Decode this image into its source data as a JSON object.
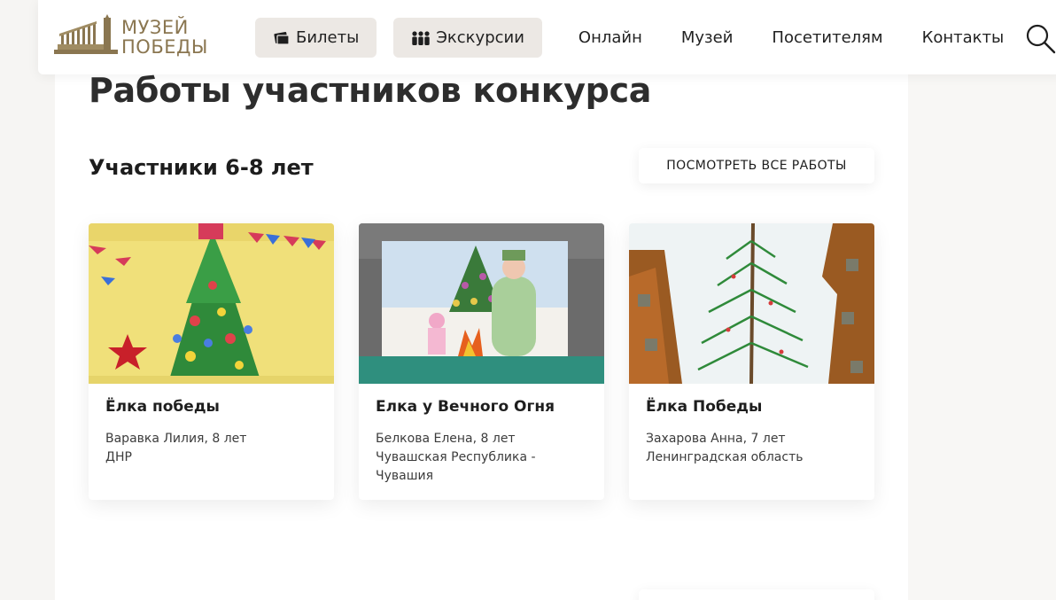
{
  "header": {
    "logo": {
      "line1": "МУЗЕЙ",
      "line2": "ПОБЕДЫ"
    },
    "nav_pills": [
      {
        "label": "Билеты",
        "icon": "ticket-icon"
      },
      {
        "label": "Экскурсии",
        "icon": "people-icon"
      }
    ],
    "nav_links": [
      "Онлайн",
      "Музей",
      "Посетителям",
      "Контакты"
    ],
    "search_icon": "search-icon"
  },
  "page": {
    "title": "Работы участников конкурса",
    "section_title": "Участники 6-8 лет",
    "view_all_label": "ПОСМОТРЕТЬ ВСЕ РАБОТЫ"
  },
  "cards": [
    {
      "title": "Ёлка победы",
      "author": "Варавка Лилия, 8 лет",
      "region": "ДНР"
    },
    {
      "title": "Елка у Вечного Огня",
      "author": "Белкова Елена, 8 лет",
      "region": "Чувашская Республика - Чувашия"
    },
    {
      "title": "Ёлка Победы",
      "author": "Захарова Анна, 7 лет",
      "region": "Ленинградская область"
    }
  ],
  "colors": {
    "brand_gold": "#8a7650",
    "pill_bg": "#ece8e4",
    "page_bg": "#f6f5f3"
  }
}
